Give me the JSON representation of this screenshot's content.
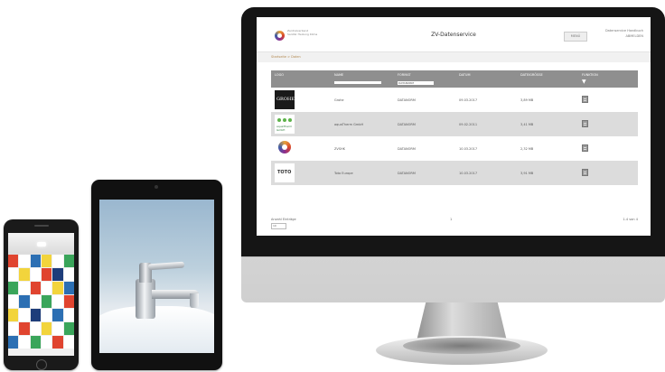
{
  "app": {
    "title": "ZV-Datenservice",
    "logo_text": "Zentralverband Sanitär Heizung Klima",
    "menu_label": "MENÜ",
    "account_label": "Datenservice Handbuch",
    "account_user": "ABMELDEN"
  },
  "breadcrumb": "Startseite > Daten",
  "table": {
    "headers": {
      "logo": "LOGO",
      "name": "NAME",
      "format": "FORMAT",
      "date": "DATUM",
      "size": "DATEIGRÖSSE",
      "function": "FUNKTION"
    },
    "format_filter": "DATANORM",
    "rows": [
      {
        "logo": "grohe",
        "logo_text": "GROHE",
        "name": "Grohe",
        "format": "DATANORM",
        "date": "09.03.2017",
        "size": "3,89 MB"
      },
      {
        "logo": "aqua",
        "logo_text": "aquaTherm GmbH",
        "name": "aquaTherm GmbH",
        "format": "DATANORM",
        "date": "09.02.2011",
        "size": "3,41 MB"
      },
      {
        "logo": "ring",
        "logo_text": "",
        "name": "ZVSHK",
        "format": "DATANORM",
        "date": "10.03.2017",
        "size": "2,32 MB"
      },
      {
        "logo": "toto",
        "logo_text": "TOTO",
        "name": "Toto Europe",
        "format": "DATANORM",
        "date": "10.03.2017",
        "size": "3,91 MB"
      }
    ]
  },
  "footer": {
    "per_page_label": "Anzahl Einträge",
    "per_page_value": "10",
    "page": "1",
    "count": "1-4 von 4"
  },
  "colors": {
    "header_bg": "#8f8f8f",
    "row_alt": "#dcdcdc",
    "breadcrumb": "#b38a52",
    "tiles": [
      "#e0442f",
      "#2c6fb3",
      "#f2d43c",
      "#3aa55a",
      "#ffffff",
      "#1e3d7a"
    ]
  }
}
